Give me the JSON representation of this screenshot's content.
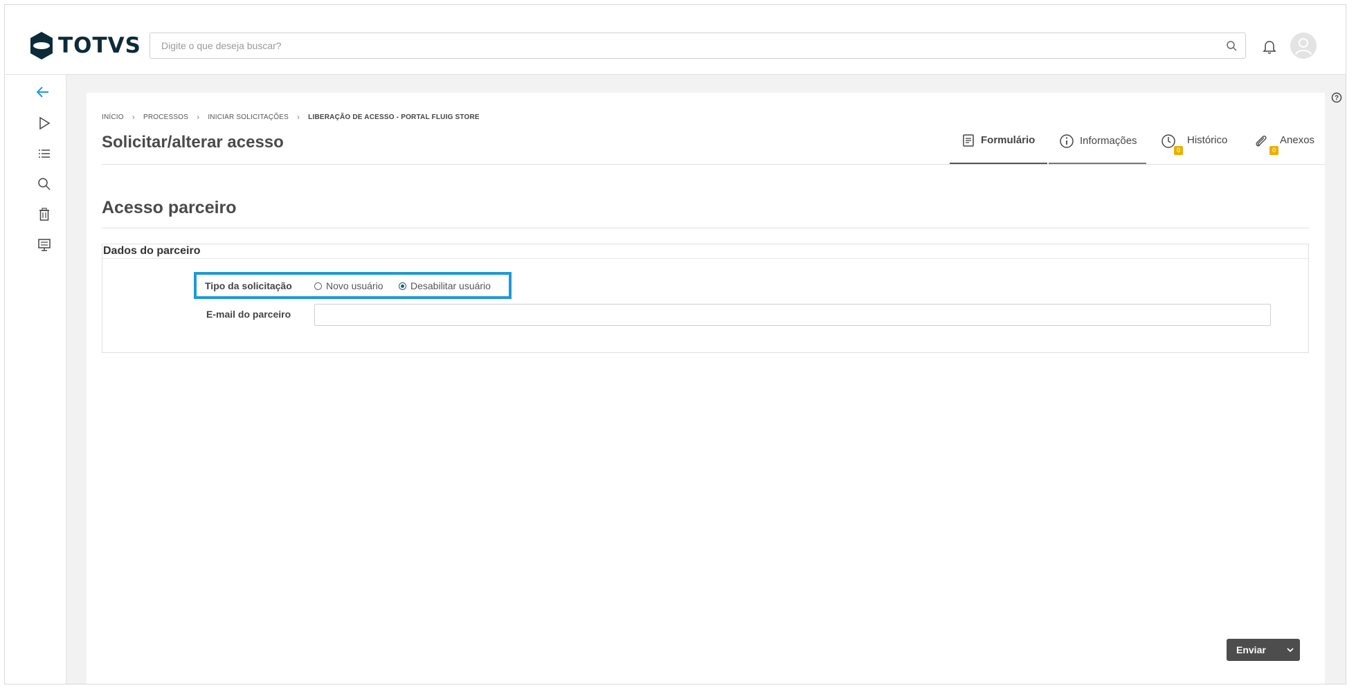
{
  "brand": {
    "name": "TOTVS"
  },
  "search": {
    "placeholder": "Digite o que deseja buscar?"
  },
  "breadcrumb": {
    "items": [
      "INÍCIO",
      "PROCESSOS",
      "INICIAR SOLICITAÇÕES"
    ],
    "current": "LIBERAÇÃO DE ACESSO - PORTAL FLUIG STORE"
  },
  "page": {
    "title": "Solicitar/alterar acesso"
  },
  "tabs": [
    {
      "label": "Formulário",
      "icon": "document-icon",
      "active": true
    },
    {
      "label": "Informações",
      "icon": "info-icon",
      "active": false
    },
    {
      "label": "Histórico",
      "icon": "clock-icon",
      "badge": "0",
      "active": false
    },
    {
      "label": "Anexos",
      "icon": "paperclip-icon",
      "badge": "0",
      "active": false
    }
  ],
  "form": {
    "section_title": "Acesso parceiro",
    "panel_title": "Dados do parceiro",
    "tipo_label": "Tipo da solicitação",
    "options": [
      {
        "label": "Novo usuário",
        "selected": false
      },
      {
        "label": "Desabilitar usuário",
        "selected": true
      }
    ],
    "email_label": "E-mail do parceiro",
    "email_value": ""
  },
  "actions": {
    "send_label": "Enviar"
  },
  "colors": {
    "accent": "#1e9ad6",
    "badge": "#e9b000",
    "button": "#4d4d4d",
    "brand": "#0c2b3a"
  }
}
